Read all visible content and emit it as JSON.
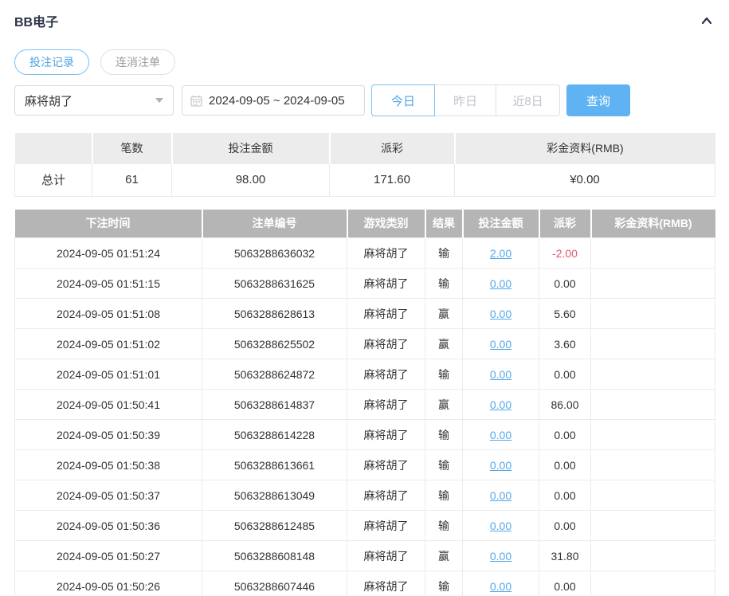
{
  "header": {
    "title": "BB电子"
  },
  "tabs": [
    {
      "label": "投注记录",
      "active": true
    },
    {
      "label": "连消注单",
      "active": false
    }
  ],
  "filters": {
    "game_select": {
      "value": "麻将胡了"
    },
    "date_range": {
      "value": "2024-09-05 ~ 2024-09-05"
    },
    "quick_buttons": [
      {
        "label": "今日",
        "active": true
      },
      {
        "label": "昨日",
        "active": false
      },
      {
        "label": "近8日",
        "active": false
      }
    ],
    "search_label": "查询"
  },
  "summary_table": {
    "headers": [
      "",
      "笔数",
      "投注金额",
      "派彩",
      "彩金资料(RMB)"
    ],
    "row": {
      "label": "总计",
      "count": "61",
      "bet_amount": "98.00",
      "payout": "171.60",
      "bonus": "¥0.00"
    }
  },
  "detail_table": {
    "headers": [
      "下注时间",
      "注单编号",
      "游戏类别",
      "结果",
      "投注金额",
      "派彩",
      "彩金资料(RMB)"
    ],
    "rows": [
      {
        "time": "2024-09-05 01:51:24",
        "order_no": "5063288636032",
        "game": "麻将胡了",
        "result": "输",
        "bet": "2.00",
        "payout": "-2.00",
        "bonus": ""
      },
      {
        "time": "2024-09-05 01:51:15",
        "order_no": "5063288631625",
        "game": "麻将胡了",
        "result": "输",
        "bet": "0.00",
        "payout": "0.00",
        "bonus": ""
      },
      {
        "time": "2024-09-05 01:51:08",
        "order_no": "5063288628613",
        "game": "麻将胡了",
        "result": "赢",
        "bet": "0.00",
        "payout": "5.60",
        "bonus": ""
      },
      {
        "time": "2024-09-05 01:51:02",
        "order_no": "5063288625502",
        "game": "麻将胡了",
        "result": "赢",
        "bet": "0.00",
        "payout": "3.60",
        "bonus": ""
      },
      {
        "time": "2024-09-05 01:51:01",
        "order_no": "5063288624872",
        "game": "麻将胡了",
        "result": "输",
        "bet": "0.00",
        "payout": "0.00",
        "bonus": ""
      },
      {
        "time": "2024-09-05 01:50:41",
        "order_no": "5063288614837",
        "game": "麻将胡了",
        "result": "赢",
        "bet": "0.00",
        "payout": "86.00",
        "bonus": ""
      },
      {
        "time": "2024-09-05 01:50:39",
        "order_no": "5063288614228",
        "game": "麻将胡了",
        "result": "输",
        "bet": "0.00",
        "payout": "0.00",
        "bonus": ""
      },
      {
        "time": "2024-09-05 01:50:38",
        "order_no": "5063288613661",
        "game": "麻将胡了",
        "result": "输",
        "bet": "0.00",
        "payout": "0.00",
        "bonus": ""
      },
      {
        "time": "2024-09-05 01:50:37",
        "order_no": "5063288613049",
        "game": "麻将胡了",
        "result": "输",
        "bet": "0.00",
        "payout": "0.00",
        "bonus": ""
      },
      {
        "time": "2024-09-05 01:50:36",
        "order_no": "5063288612485",
        "game": "麻将胡了",
        "result": "输",
        "bet": "0.00",
        "payout": "0.00",
        "bonus": ""
      },
      {
        "time": "2024-09-05 01:50:27",
        "order_no": "5063288608148",
        "game": "麻将胡了",
        "result": "赢",
        "bet": "0.00",
        "payout": "31.80",
        "bonus": ""
      },
      {
        "time": "2024-09-05 01:50:26",
        "order_no": "5063288607446",
        "game": "麻将胡了",
        "result": "输",
        "bet": "0.00",
        "payout": "0.00",
        "bonus": ""
      }
    ]
  },
  "colors": {
    "accent": "#4da3e8",
    "query_button": "#5fb3f2",
    "link": "#54a7e8",
    "negative": "#e75565",
    "detail_header_bg": "#b5b5b5",
    "summary_header_bg": "#ececec"
  }
}
